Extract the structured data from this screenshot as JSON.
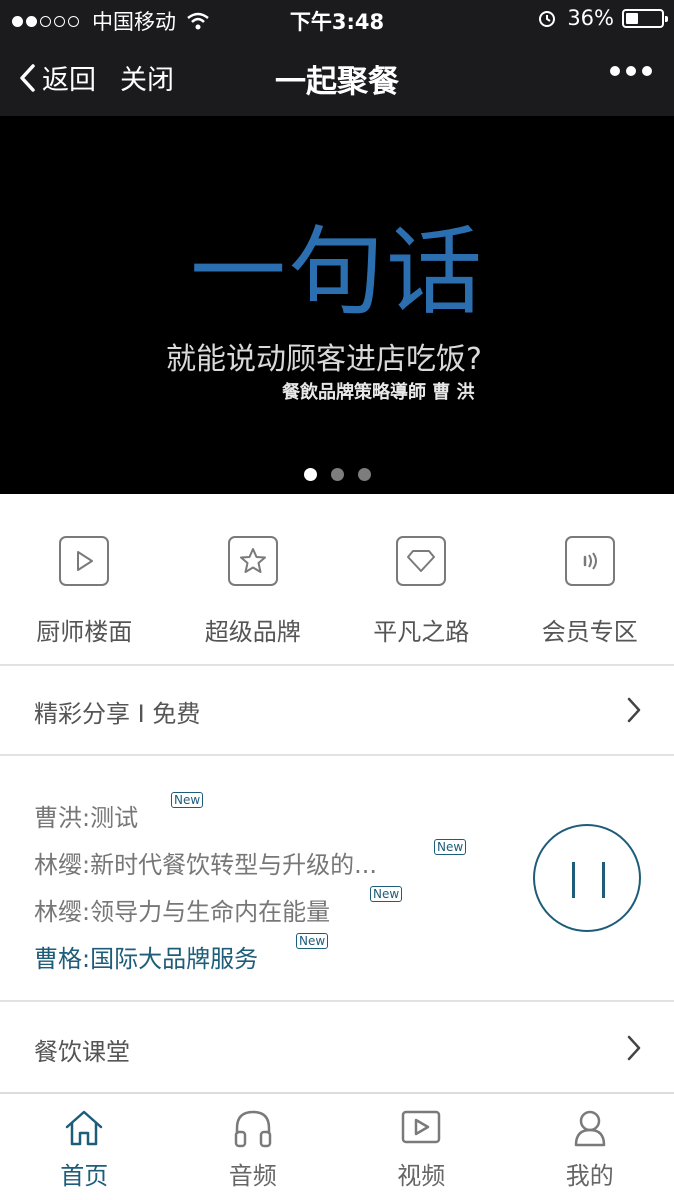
{
  "status_bar": {
    "carrier": "中国移动",
    "time": "下午3:48",
    "battery": "36%",
    "battery_level": 0.36
  },
  "nav": {
    "back_label": "返回",
    "close_label": "关闭",
    "title": "一起聚餐"
  },
  "banner": {
    "headline": "一句话",
    "subtitle": "就能说动顾客进店吃饭?",
    "author": "餐飲品牌策略導師 曹 洪",
    "page_count": 3,
    "active_page": 1
  },
  "categories": [
    {
      "label": "厨师楼面",
      "icon": "play-icon"
    },
    {
      "label": "超级品牌",
      "icon": "star-icon"
    },
    {
      "label": "平凡之路",
      "icon": "diamond-icon"
    },
    {
      "label": "会员专区",
      "icon": "sound-icon"
    }
  ],
  "share_row": {
    "label": "精彩分享 I 免费"
  },
  "audio_list": [
    {
      "text": "曹洪:测试",
      "tag": "New",
      "active": false
    },
    {
      "text": "林缨:新时代餐饮转型与升级的...",
      "tag": "New",
      "active": false
    },
    {
      "text": "林缨:领导力与生命内在能量",
      "tag": "New",
      "active": false
    },
    {
      "text": "曹格:国际大品牌服务",
      "tag": "New",
      "active": true
    }
  ],
  "class_row": {
    "label": "餐饮课堂"
  },
  "tabs": [
    {
      "label": "首页",
      "icon": "home-icon",
      "active": true
    },
    {
      "label": "音频",
      "icon": "headphones-icon",
      "active": false
    },
    {
      "label": "视频",
      "icon": "video-icon",
      "active": false
    },
    {
      "label": "我的",
      "icon": "user-icon",
      "active": false
    }
  ],
  "colors": {
    "accent": "#1e5d79",
    "bar_bg": "#1b1b1d",
    "banner_headline": "#2b6fb1"
  }
}
